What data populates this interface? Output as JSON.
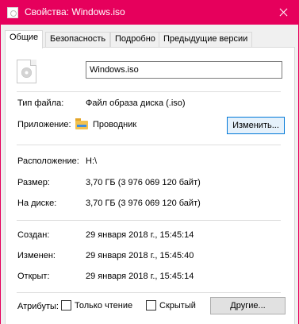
{
  "window": {
    "title": "Свойства: Windows.iso"
  },
  "tabs": [
    {
      "label": "Общие"
    },
    {
      "label": "Безопасность"
    },
    {
      "label": "Подробно"
    },
    {
      "label": "Предыдущие версии"
    }
  ],
  "file": {
    "name": "Windows.iso",
    "icon": "disc-image-file-icon"
  },
  "labels": {
    "type": "Тип файла:",
    "app": "Приложение:",
    "location": "Расположение:",
    "size": "Размер:",
    "on_disk": "На диске:",
    "created": "Создан:",
    "modified": "Изменен:",
    "opened": "Открыт:",
    "attributes": "Атрибуты:"
  },
  "values": {
    "type": "Файл образа диска (.iso)",
    "app": "Проводник",
    "location": "H:\\",
    "size": "3,70 ГБ (3 976 069 120 байт)",
    "on_disk": "3,70 ГБ (3 976 069 120 байт)",
    "created": "29 января 2018 г., 15:45:14",
    "modified": "29 января 2018 г., 15:45:40",
    "opened": "29 января 2018 г., 15:45:14"
  },
  "buttons": {
    "change": "Изменить...",
    "other": "Другие..."
  },
  "attributes": {
    "readonly_label": "Только чтение",
    "readonly_checked": false,
    "hidden_label": "Скрытый",
    "hidden_checked": false
  },
  "colors": {
    "titlebar": "#e6005c"
  }
}
